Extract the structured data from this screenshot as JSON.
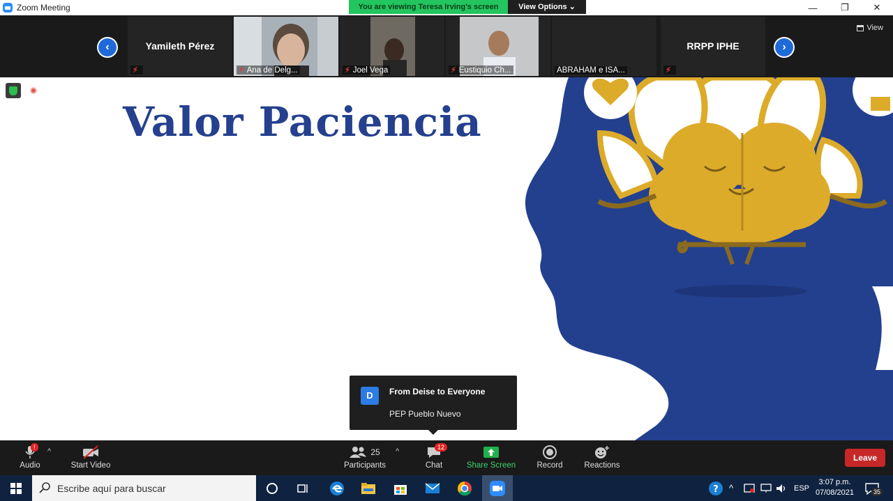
{
  "window": {
    "title": "Zoom Meeting"
  },
  "banner": {
    "viewing": "You are viewing Teresa Irving's screen",
    "view_options": "View Options"
  },
  "strip": {
    "view_label": "View",
    "participants": [
      {
        "name": "Yamileth Pérez",
        "type": "name"
      },
      {
        "label": "Ana  de Delg...",
        "type": "video"
      },
      {
        "label": "Joel Vega",
        "type": "video"
      },
      {
        "label": "Eustiquio Ch...",
        "type": "video"
      },
      {
        "label": "ABRAHAM e ISA...",
        "type": "label"
      },
      {
        "name": "RRPP IPHE",
        "type": "name"
      }
    ]
  },
  "slide": {
    "title": "Valor Paciencia",
    "colors": {
      "title": "#24408e",
      "head": "#23408f",
      "brain": "#ddab2a"
    }
  },
  "chat_popup": {
    "avatar": "D",
    "from": "From Deise to Everyone",
    "message": "PEP Pueblo Nuevo"
  },
  "toolbar": {
    "audio": "Audio",
    "audio_badge": "!",
    "video": "Start Video",
    "participants": "Participants",
    "participants_count": "25",
    "chat": "Chat",
    "chat_badge": "12",
    "share": "Share Screen",
    "record": "Record",
    "reactions": "Reactions",
    "leave": "Leave"
  },
  "taskbar": {
    "search_placeholder": "Escribe aquí para buscar",
    "lang": "ESP",
    "time": "3:07 p.m.",
    "date": "07/08/2021",
    "notif_count": "35"
  }
}
